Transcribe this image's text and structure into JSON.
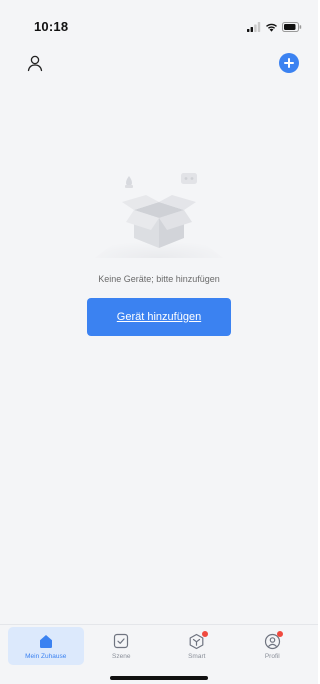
{
  "status_bar": {
    "time": "10:18"
  },
  "header": {
    "profile_icon": "person-icon",
    "add_icon": "plus-circle-icon"
  },
  "empty_state": {
    "message": "Keine Geräte; bitte hinzufügen",
    "button_label": "Gerät hinzufügen"
  },
  "tabs": [
    {
      "label": "Mein Zuhause",
      "icon": "home-icon",
      "active": true,
      "badge": false
    },
    {
      "label": "Szene",
      "icon": "scene-checkbox-icon",
      "active": false,
      "badge": false
    },
    {
      "label": "Smart",
      "icon": "smart-cube-icon",
      "active": false,
      "badge": true
    },
    {
      "label": "Profil",
      "icon": "profile-icon",
      "active": false,
      "badge": true
    }
  ],
  "colors": {
    "accent": "#3b82f1",
    "background": "#f4f5f7",
    "badge": "#f04a3f"
  }
}
